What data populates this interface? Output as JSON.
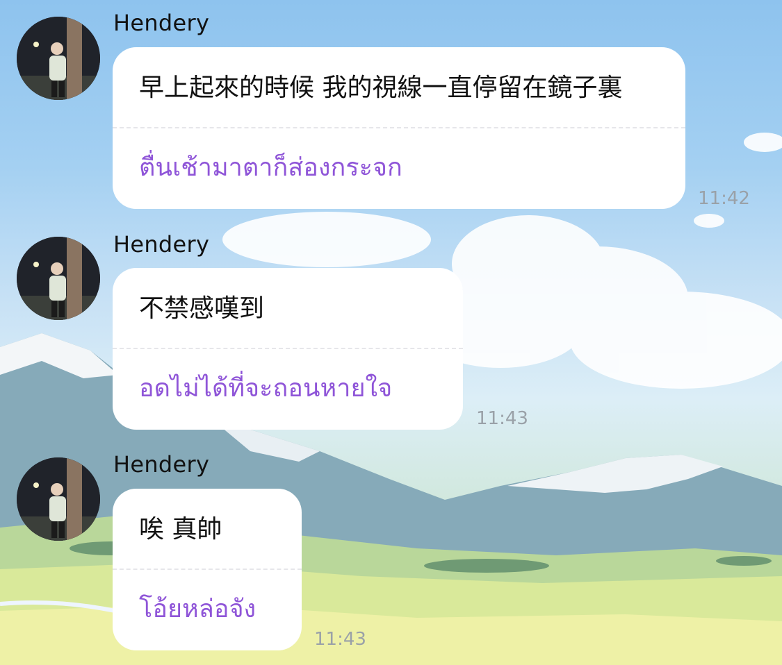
{
  "messages": [
    {
      "sender": "Hendery",
      "original": "早上起來的時候 我的視線一直停留在鏡子裏",
      "translation": "ตื่นเช้ามาตาก็ส่องกระจก",
      "time": "11:42"
    },
    {
      "sender": "Hendery",
      "original": "不禁感嘆到",
      "translation": "อดไม่ได้ที่จะถอนหายใจ",
      "time": "11:43"
    },
    {
      "sender": "Hendery",
      "original": "唉 真帥",
      "translation": "โอ้ยหล่อจัง",
      "time": "11:43"
    }
  ],
  "colors": {
    "translation_text": "#8f55d8",
    "bubble": "#ffffff",
    "timestamp": "#9aa1a8"
  }
}
